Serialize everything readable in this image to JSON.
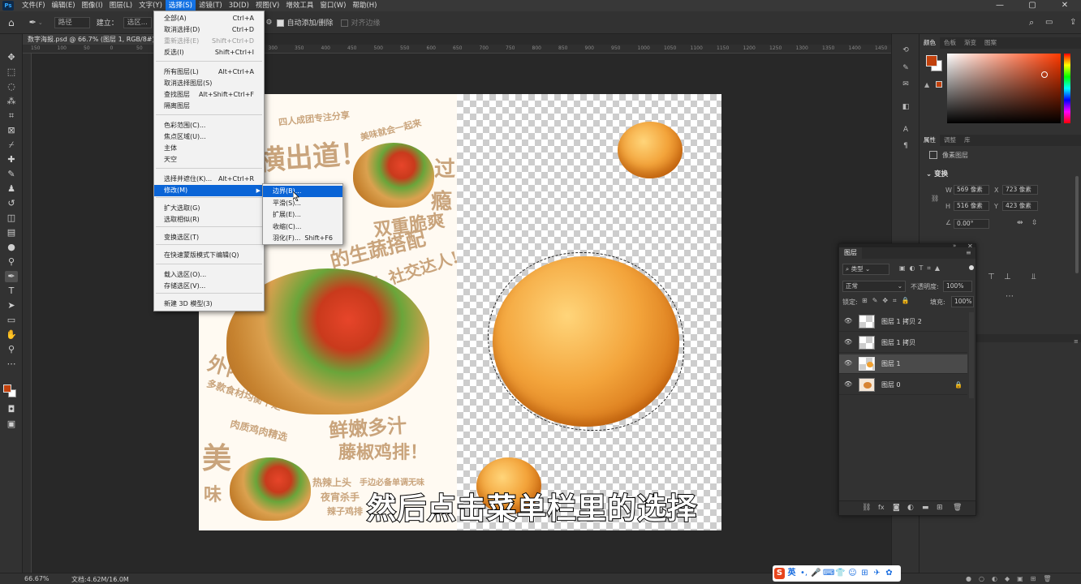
{
  "app": {
    "logo": "Ps",
    "menus": [
      "文件(F)",
      "编辑(E)",
      "图像(I)",
      "图层(L)",
      "文字(Y)",
      "选择(S)",
      "滤镜(T)",
      "3D(D)",
      "视图(V)",
      "增效工具",
      "窗口(W)",
      "帮助(H)"
    ],
    "active_menu_index": 5,
    "window_controls": [
      "—",
      "▢",
      "✕"
    ]
  },
  "options_bar": {
    "mode": "路径",
    "build": "建立：",
    "select_btn": "选区...",
    "auto_add": "自动添加/删除",
    "align_edges": "对齐边缘"
  },
  "document": {
    "tab_title": "数字海报.psd @ 66.7% (图层 1, RGB/8#)",
    "tab_close": "×",
    "zoom": "66.67%",
    "doc_size": "文档:4.62M/16.0M",
    "ruler_top": [
      "150",
      "100",
      "50",
      "0",
      "50",
      "100",
      "150",
      "200",
      "250",
      "300",
      "350",
      "400",
      "450",
      "500",
      "550",
      "600",
      "650",
      "700",
      "750",
      "800",
      "850",
      "900",
      "950",
      "1000",
      "1050",
      "1100",
      "1150",
      "1200",
      "1250",
      "1300",
      "1350",
      "1400",
      "1450"
    ]
  },
  "select_menu": {
    "items": [
      {
        "label": "全部(A)",
        "shortcut": "Ctrl+A",
        "disabled": false
      },
      {
        "label": "取消选择(D)",
        "shortcut": "Ctrl+D",
        "disabled": false
      },
      {
        "label": "重新选择(E)",
        "shortcut": "Shift+Ctrl+D",
        "disabled": true
      },
      {
        "label": "反选(I)",
        "shortcut": "Shift+Ctrl+I",
        "disabled": false
      },
      {
        "label": "所有图层(L)",
        "shortcut": "Alt+Ctrl+A",
        "disabled": false
      },
      {
        "label": "取消选择图层(S)",
        "shortcut": "",
        "disabled": false
      },
      {
        "label": "查找图层",
        "shortcut": "Alt+Shift+Ctrl+F",
        "disabled": false
      },
      {
        "label": "隔离图层",
        "shortcut": "",
        "disabled": false
      },
      {
        "label": "色彩范围(C)...",
        "shortcut": "",
        "disabled": false
      },
      {
        "label": "焦点区域(U)...",
        "shortcut": "",
        "disabled": false
      },
      {
        "label": "主体",
        "shortcut": "",
        "disabled": false
      },
      {
        "label": "天空",
        "shortcut": "",
        "disabled": false
      },
      {
        "label": "选择并遮住(K)...",
        "shortcut": "Alt+Ctrl+R",
        "disabled": false
      },
      {
        "label": "修改(M)",
        "shortcut": "",
        "disabled": false
      },
      {
        "label": "扩大选取(G)",
        "shortcut": "",
        "disabled": false
      },
      {
        "label": "选取相似(R)",
        "shortcut": "",
        "disabled": false
      },
      {
        "label": "变换选区(T)",
        "shortcut": "",
        "disabled": false
      },
      {
        "label": "在快速蒙版模式下编辑(Q)",
        "shortcut": "",
        "disabled": false
      },
      {
        "label": "载入选区(O)...",
        "shortcut": "",
        "disabled": false
      },
      {
        "label": "存储选区(V)...",
        "shortcut": "",
        "disabled": false
      },
      {
        "label": "新建 3D 模型(3)",
        "shortcut": "",
        "disabled": false
      }
    ],
    "highlighted": "修改(M)"
  },
  "modify_submenu": {
    "items": [
      {
        "label": "边界(B)...",
        "shortcut": ""
      },
      {
        "label": "平滑(S)...",
        "shortcut": ""
      },
      {
        "label": "扩展(E)...",
        "shortcut": ""
      },
      {
        "label": "收缩(C)...",
        "shortcut": ""
      },
      {
        "label": "羽化(F)...",
        "shortcut": "Shift+F6"
      }
    ],
    "highlighted": "边界(B)..."
  },
  "poster_text": {
    "t1": "四人成团专注分享",
    "t2": "美味就会一起来",
    "t3": "横出道！",
    "t4": "过",
    "t5": "瘾",
    "t6": "双重脆爽",
    "t7": "的生蔬搭配",
    "t8": "爽",
    "t9": "口感韧性TOP！社交达人!!!",
    "t10": "外内小可爱",
    "t11": "鲜嫩多汁",
    "t12": "藤椒鸡排！",
    "t13": "多款食材均衡十足",
    "t14": "肉质鸡肉精选",
    "t15": "美",
    "t16": "味",
    "t17": "热辣上头",
    "t18": "夜宵杀手",
    "t19": "辣子鸡排",
    "t20": "手边必备单调无味"
  },
  "right_panel": {
    "color_tabs": [
      "颜色",
      "色板",
      "渐变",
      "图案"
    ],
    "props_tabs": [
      "属性",
      "调整",
      "库"
    ],
    "layer_kind": "像素图层",
    "transform_title": "变换",
    "w_label": "W",
    "w_value": "569 像素",
    "x_label": "X",
    "x_value": "723 像素",
    "h_label": "H",
    "h_value": "516 像素",
    "y_label": "Y",
    "y_value": "423 像素",
    "angle_value": "0.00°",
    "fg_color": "#c2410c",
    "bg_color": "#ffffff"
  },
  "layers": {
    "title": "图层",
    "filter_label": "类型",
    "blend_mode": "正常",
    "opacity_label": "不透明度:",
    "opacity_value": "100%",
    "lock_label": "锁定:",
    "fill_label": "填充:",
    "fill_value": "100%",
    "items": [
      {
        "name": "图层 1 拷贝 2",
        "selected": false,
        "locked": false
      },
      {
        "name": "图层 1 拷贝",
        "selected": false,
        "locked": false
      },
      {
        "name": "图层 1",
        "selected": true,
        "locked": false
      },
      {
        "name": "图层 0",
        "selected": false,
        "locked": true
      }
    ]
  },
  "subtitle": "然后点击菜单栏里的选择",
  "ime": {
    "label": "英"
  }
}
